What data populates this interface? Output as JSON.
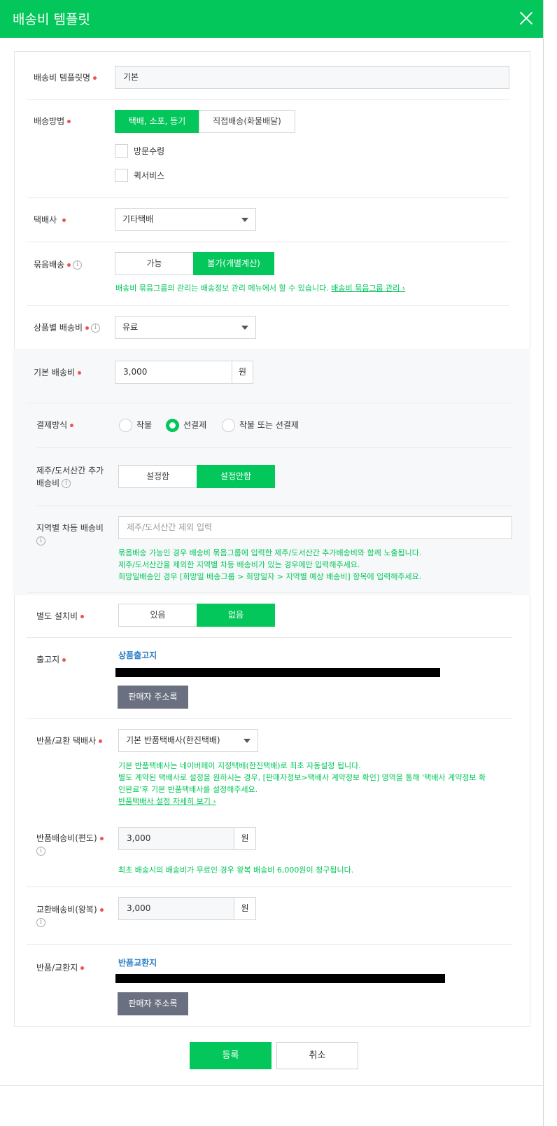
{
  "header": {
    "title": "배송비 템플릿"
  },
  "template_name": {
    "label": "배송비 템플릿명",
    "value": "기본"
  },
  "delivery_method": {
    "label": "배송방법",
    "options": [
      "택배, 소포, 등기",
      "직접배송(화물배달)"
    ],
    "checkboxes": [
      "방문수령",
      "퀵서비스"
    ]
  },
  "courier": {
    "label": "택배사",
    "value": "기타택배"
  },
  "bundle": {
    "label": "묶음배송",
    "options": [
      "가능",
      "불가(개별계산)"
    ],
    "help_text": "배송비 묶음그룹의 관리는 배송정보 관리 메뉴에서 할 수 있습니다.",
    "help_link": "배송비 묶음그룹 관리 ›"
  },
  "fee_type": {
    "label": "상품별 배송비",
    "value": "유료"
  },
  "base_fee": {
    "label": "기본 배송비",
    "value": "3,000",
    "unit": "원"
  },
  "payment": {
    "label": "결제방식",
    "options": [
      "착불",
      "선결제",
      "착불 또는 선결제"
    ]
  },
  "island_fee": {
    "label_line1": "제주/도서산간 추가",
    "label_line2": "배송비",
    "options": [
      "설정함",
      "설정안함"
    ]
  },
  "regional_fee": {
    "label": "지역별 차등 배송비",
    "placeholder": "제주/도서산간 제외 입력",
    "help": [
      "묶음배송 가능인 경우 배송비 묶음그룹에 입력한 제주/도서산간 추가배송비와 함께 노출됩니다.",
      "제주/도서산간을 제외한 지역별 차등 배송비가 있는 경우에만 입력해주세요.",
      "희망일배송인 경우 [희망일 배송그룹 > 희망일자 > 지역별 예상 배송비] 항목에 입력해주세요."
    ]
  },
  "install_fee": {
    "label": "별도 설치비",
    "options": [
      "있음",
      "없음"
    ]
  },
  "ship_from": {
    "label": "출고지",
    "title": "상품출고지",
    "button": "판매자 주소록"
  },
  "return_courier": {
    "label": "반품/교환 택배사",
    "value": "기본 반품택배사(한진택배)",
    "help": [
      "기본 반품택배사는 네이버페이 지정택배(한진택배)로 최초 자동설정 됩니다.",
      "별도 계약된 택배사로 설정을 원하시는 경우, [판매자정보>택배사 계약정보 확인] 영역을 통해 '택배사 계약정보 확",
      "인완료'후 기본 반품택배사를 설정해주세요."
    ],
    "help_link": "반품택배사 설정 자세히 보기 ›"
  },
  "return_fee": {
    "label": "반품배송비(편도)",
    "value": "3,000",
    "unit": "원",
    "help": "최초 배송시의 배송비가 무료인 경우 왕복 배송비 6,000원이 청구됩니다."
  },
  "exchange_fee": {
    "label": "교환배송비(왕복)",
    "value": "3,000",
    "unit": "원"
  },
  "return_address": {
    "label": "반품/교환지",
    "title": "반품교환지",
    "button": "판매자 주소록"
  },
  "footer": {
    "submit": "등록",
    "cancel": "취소"
  },
  "colors": {
    "brand": "#03c75a",
    "required": "#ec5454",
    "link_blue": "#2f7fc4",
    "button_gray": "#6b7080"
  }
}
